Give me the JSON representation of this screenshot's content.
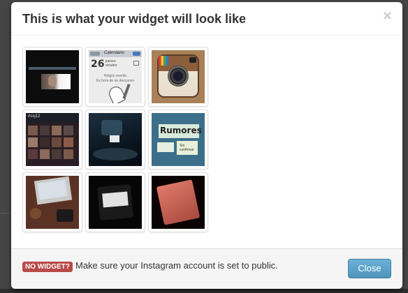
{
  "modal": {
    "title": "This is what your widget will look like",
    "close_glyph": "×"
  },
  "images": [
    {
      "name": "screenshot-dark-video",
      "kind": "photo"
    },
    {
      "name": "calendar-phone-screenshot",
      "kind": "photo",
      "text": {
        "topbar": "Calendario",
        "day": "26",
        "weekday": "jueves",
        "month": "octubre",
        "empty_line1": "Ningún evento",
        "empty_line2": "Es hora de un descanso"
      }
    },
    {
      "name": "instagram-app-icon",
      "kind": "photo"
    },
    {
      "name": "photo-grid-screenshot",
      "kind": "photo",
      "text": {
        "header": "#ssj12"
      }
    },
    {
      "name": "dark-desk-photo",
      "kind": "photo"
    },
    {
      "name": "rumores-sticky-notes",
      "kind": "photo",
      "text": {
        "title": "Rumores",
        "note": "Sin confirmar"
      }
    },
    {
      "name": "laptop-desk-photo",
      "kind": "photo"
    },
    {
      "name": "tablet-photo",
      "kind": "photo"
    },
    {
      "name": "pink-phone-photo",
      "kind": "photo"
    }
  ],
  "footer": {
    "badge": "NO WIDGET?",
    "message": "Make sure your Instagram account is set to public.",
    "close_button": "Close"
  },
  "colors": {
    "badge_bg": "#b94a48",
    "button_bg": "#5ba3c9",
    "overlay": "#3d3d3d"
  }
}
